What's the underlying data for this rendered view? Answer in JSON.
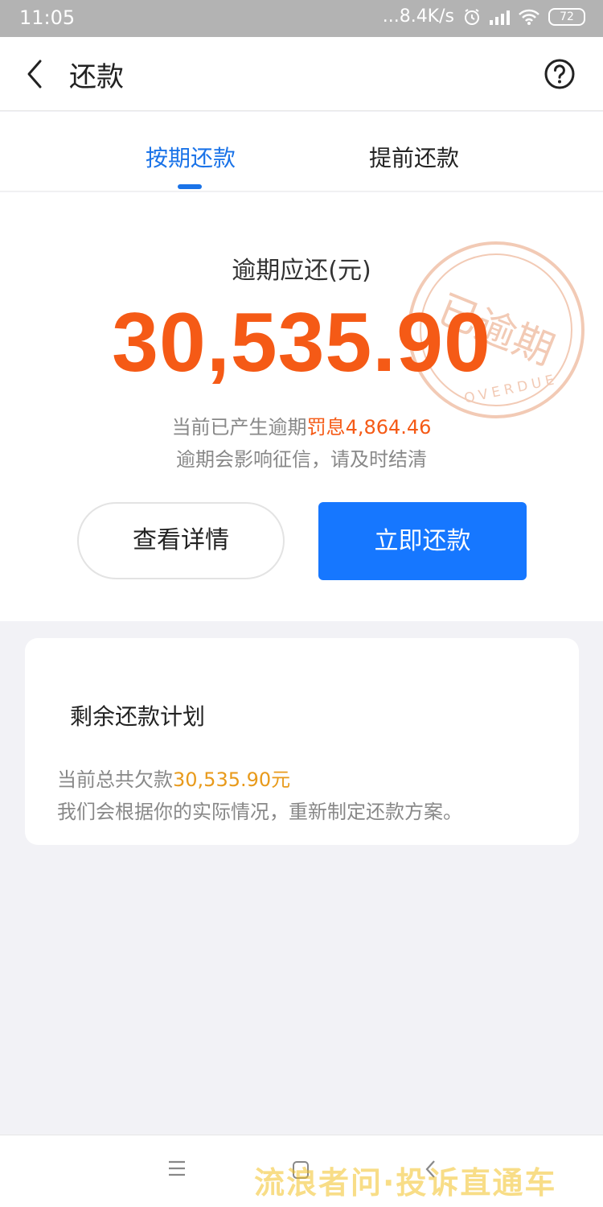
{
  "status_bar": {
    "time": "11:05",
    "network_speed": "...8.4K/s",
    "battery": "72",
    "icons": [
      "alarm-icon",
      "signal-icon",
      "wifi-icon",
      "battery-icon"
    ]
  },
  "nav": {
    "title": "还款",
    "back_icon": "chevron-left-icon",
    "help_icon": "help-circle-icon"
  },
  "tabs": [
    {
      "label": "按期还款",
      "active": true
    },
    {
      "label": "提前还款",
      "active": false
    }
  ],
  "hero": {
    "label": "逾期应还(元)",
    "amount": "30,535.90",
    "penalty_prefix": "当前已产生逾期",
    "penalty_label": "罚息",
    "penalty_value": "4,864.46",
    "warning": "逾期会影响征信，请及时结清",
    "stamp_text": "已逾期",
    "stamp_subtext": "OVERDUE"
  },
  "buttons": {
    "detail": "查看详情",
    "repay": "立即还款"
  },
  "plan": {
    "title": "剩余还款计划",
    "debt_prefix": "当前总共欠款",
    "debt_value": "30,535.90",
    "debt_unit": "元",
    "description": "我们会根据你的实际情况，重新制定还款方案。"
  },
  "bottom_nav": {
    "icons": [
      "menu-icon",
      "home-icon",
      "back-icon"
    ]
  },
  "watermark": "流浪者问·投诉直通车",
  "colors": {
    "accent_blue": "#1677ff",
    "tab_blue": "#1a73e8",
    "overdue_orange": "#f55a16",
    "debt_orange": "#e89a1b",
    "stamp": "#e8a07a"
  }
}
